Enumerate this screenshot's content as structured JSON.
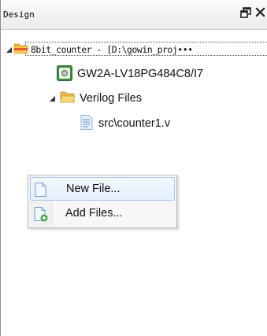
{
  "panel": {
    "title": "Design",
    "float_icon": "float-window-icon",
    "close_icon": "close-icon",
    "float_glyph": "Ɇ",
    "close_glyph": "×"
  },
  "tree": {
    "project": {
      "label": "8bit_counter - [D:\\gowin_proj•••",
      "icon": "project-folder-icon",
      "expanded": true
    },
    "device": {
      "label": "GW2A-LV18PG484C8/I7",
      "icon": "chip-icon"
    },
    "verilog_folder": {
      "label": "Verilog Files",
      "icon": "folder-icon",
      "expanded": true
    },
    "file": {
      "label": "src\\counter1.v",
      "icon": "file-icon"
    }
  },
  "context_menu": {
    "items": [
      {
        "label": "New File...",
        "icon": "new-file-icon",
        "highlighted": true
      },
      {
        "label": "Add Files...",
        "icon": "add-file-icon",
        "highlighted": false
      }
    ]
  },
  "colors": {
    "highlight_border": "#a8c8ec",
    "folder_yellow": "#f4c04a",
    "chip_green": "#3c8a3c"
  }
}
